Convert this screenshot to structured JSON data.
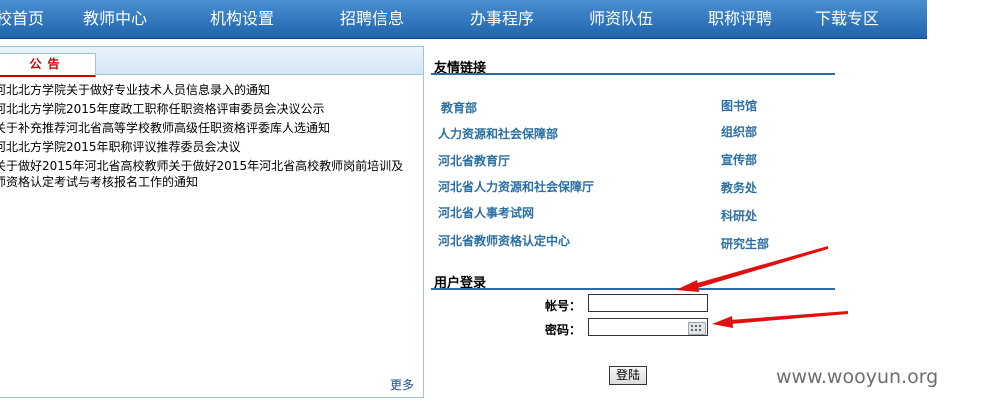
{
  "nav": {
    "items": [
      "校首页",
      "教师中心",
      "机构设置",
      "招聘信息",
      "办事程序",
      "师资队伍",
      "职称评聘",
      "下载专区"
    ]
  },
  "notice": {
    "tab_label": "公告",
    "items": [
      "河北北方学院关于做好专业技术人员信息录入的通知",
      "河北北方学院2015年度政工职称任职资格评审委员会决议公示",
      "关于补充推荐河北省高等学校教师高级任职资格评委库人选通知",
      "河北北方学院2015年职称评议推荐委员会决议",
      "关于做好2015年河北省高校教师关于做好2015年河北省高校教师岗前培训及师资格认定考试与考核报名工作的通知"
    ],
    "more_label": "更多"
  },
  "links": {
    "title": "友情链接",
    "left": [
      "教育部",
      "人力资源和社会保障部",
      "河北省教育厅",
      "河北省人力资源和社会保障厅",
      "河北省人事考试网",
      "河北省教师资格认定中心"
    ],
    "right": [
      "图书馆",
      "组织部",
      "宣传部",
      "教务处",
      "科研处",
      "研究生部"
    ]
  },
  "login": {
    "title": "用户登录",
    "account_label": "帐号：",
    "password_label": "密码：",
    "account_value": "",
    "password_value": "",
    "submit_label": "登陆"
  },
  "annotations": {
    "arrow_color": "#e01010"
  },
  "watermark": "www.wooyun.org",
  "colors": {
    "nav_bg": "#1f64ad",
    "link": "#2c6fa3",
    "notice_tab": "#d10000"
  }
}
